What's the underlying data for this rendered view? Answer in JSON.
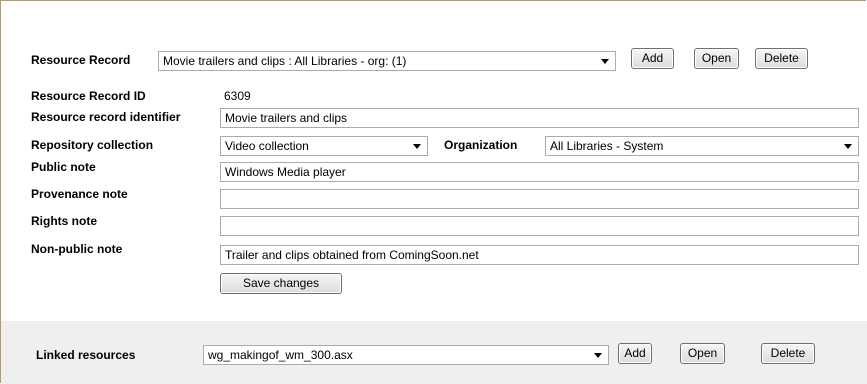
{
  "resource_record": {
    "label": "Resource Record",
    "selected": "Movie trailers and clips : All Libraries - org: (1)",
    "add_label": "Add",
    "open_label": "Open",
    "delete_label": "Delete"
  },
  "fields": {
    "record_id": {
      "label": "Resource Record ID",
      "value": "6309"
    },
    "identifier": {
      "label": "Resource record identifier",
      "value": "Movie trailers and clips"
    },
    "collection": {
      "label": "Repository collection",
      "value": "Video collection"
    },
    "organization": {
      "label": "Organization",
      "value": "All Libraries - System"
    },
    "public_note": {
      "label": "Public note",
      "value": "Windows Media player"
    },
    "provenance_note": {
      "label": "Provenance note",
      "value": ""
    },
    "rights_note": {
      "label": "Rights note",
      "value": ""
    },
    "nonpublic_note": {
      "label": "Non-public note",
      "value": "Trailer and clips obtained from ComingSoon.net"
    }
  },
  "save_label": "Save changes",
  "linked": {
    "label": "Linked resources",
    "selected": "wg_makingof_wm_300.asx",
    "add_label": "Add",
    "open_label": "Open",
    "delete_label": "Delete"
  }
}
